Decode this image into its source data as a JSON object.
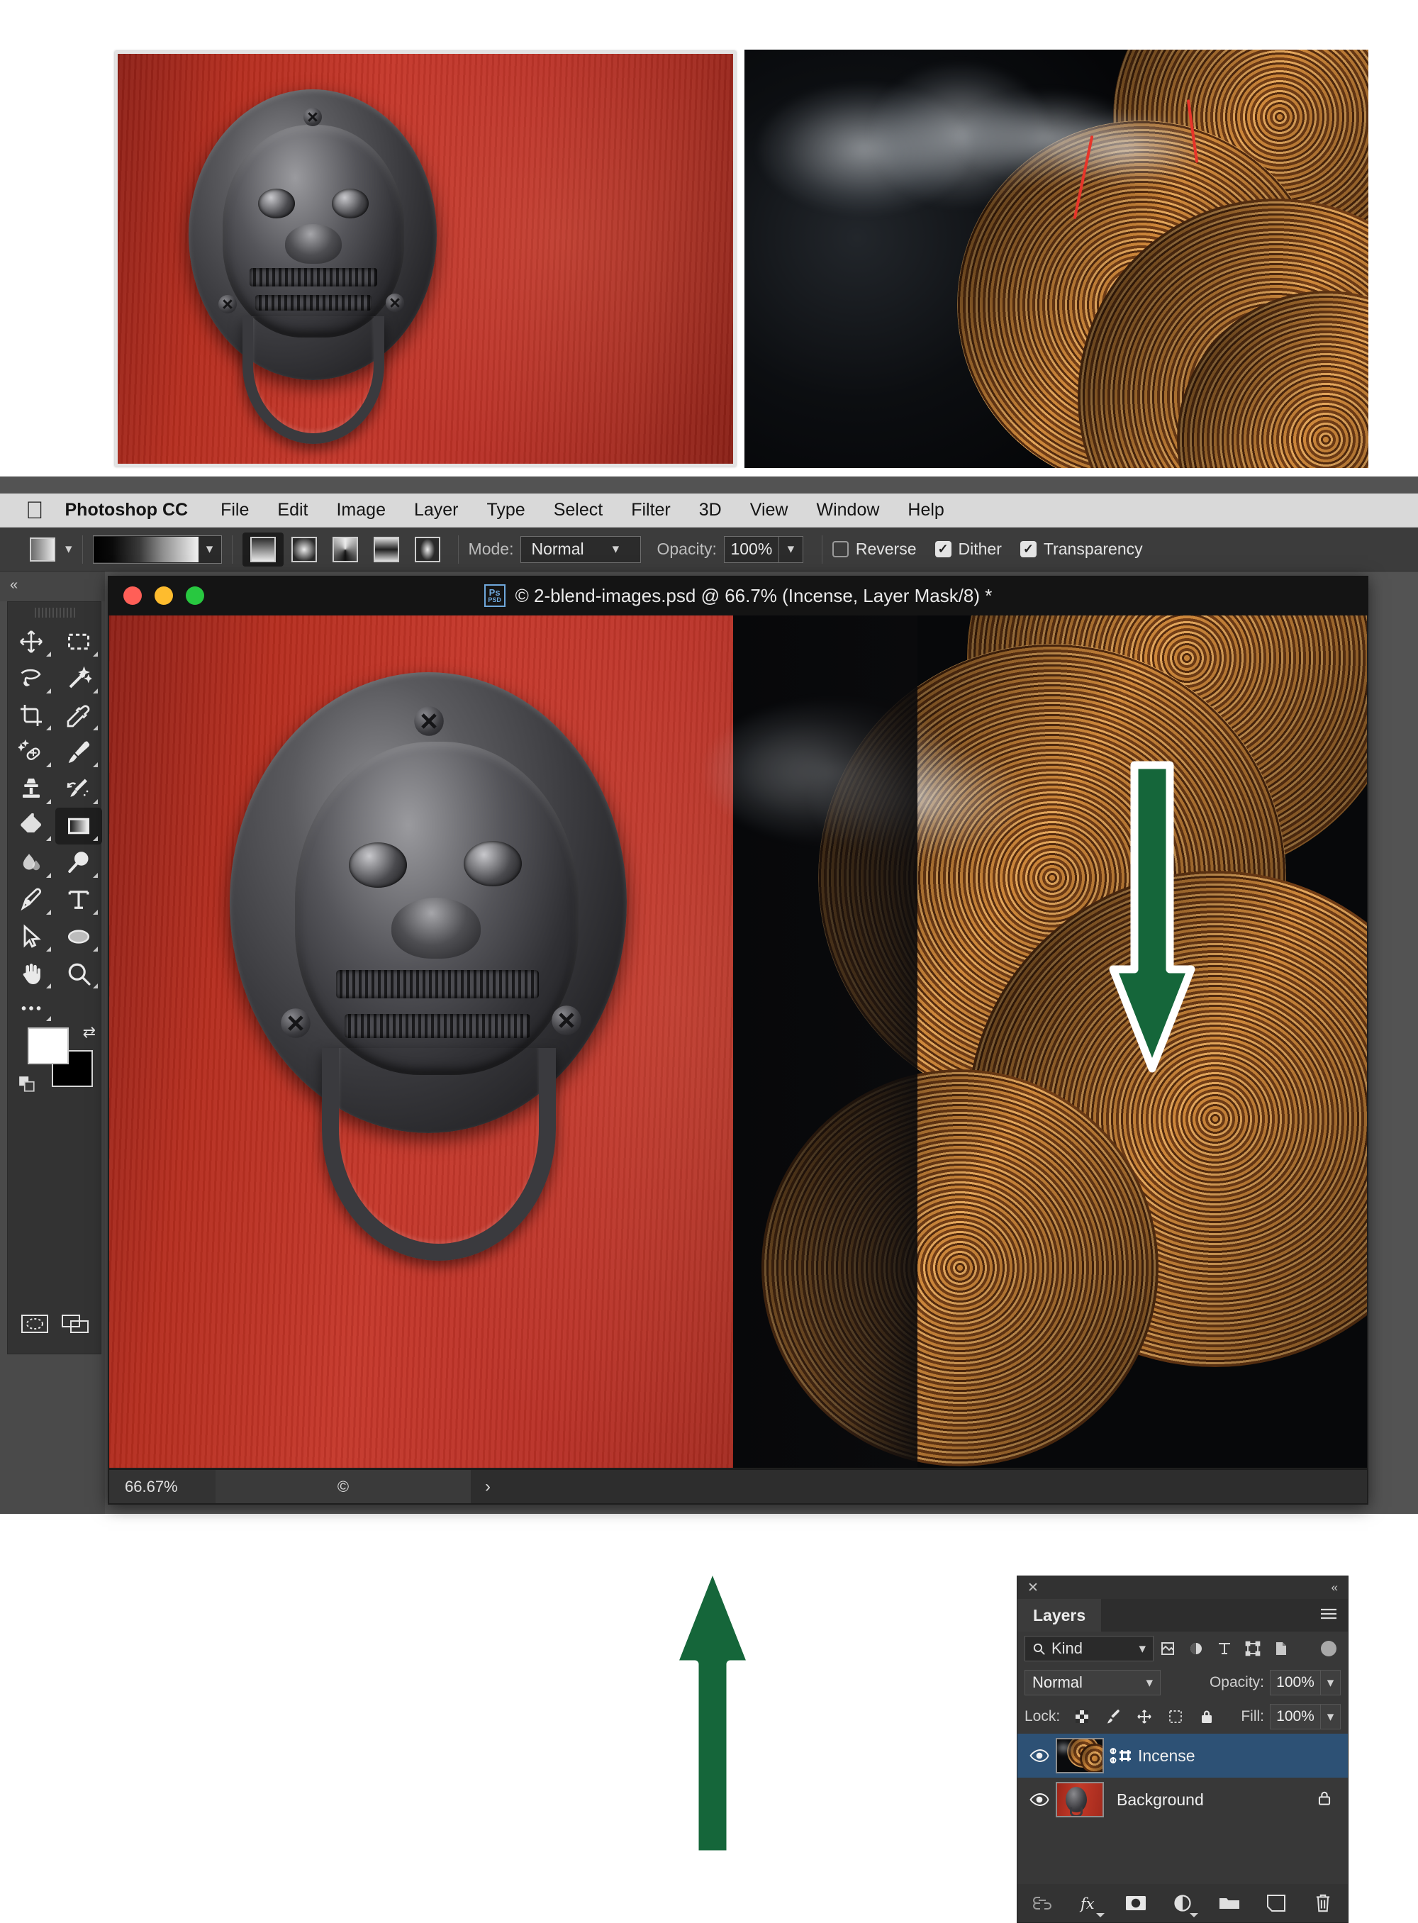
{
  "reference_images": [
    {
      "name": "door-knocker-photo",
      "alt": "Chinese lion-head door knocker on red door"
    },
    {
      "name": "incense-coils-photo",
      "alt": "Spiral incense coils with smoke on dark background"
    }
  ],
  "menubar": {
    "apple_glyph": "\u0001",
    "brand": "Photoshop CC",
    "items": [
      "File",
      "Edit",
      "Image",
      "Layer",
      "Type",
      "Select",
      "Filter",
      "3D",
      "View",
      "Window",
      "Help"
    ]
  },
  "options_bar": {
    "gradient_swatch_label": "gradient-swatch",
    "gradient_preview_label": "black-to-white-gradient",
    "gradient_types": [
      {
        "name": "linear-gradient",
        "active": true
      },
      {
        "name": "radial-gradient",
        "active": false
      },
      {
        "name": "angle-gradient",
        "active": false
      },
      {
        "name": "reflected-gradient",
        "active": false
      },
      {
        "name": "diamond-gradient",
        "active": false
      }
    ],
    "mode_label": "Mode:",
    "mode_value": "Normal",
    "opacity_label": "Opacity:",
    "opacity_value": "100%",
    "checkboxes": [
      {
        "label": "Reverse",
        "checked": false
      },
      {
        "label": "Dither",
        "checked": true
      },
      {
        "label": "Transparency",
        "checked": true
      }
    ]
  },
  "toolbar": {
    "collapse_glyph": "«",
    "tools": [
      {
        "name": "move-tool"
      },
      {
        "name": "rectangular-marquee-tool"
      },
      {
        "name": "lasso-tool"
      },
      {
        "name": "magic-wand-tool"
      },
      {
        "name": "crop-tool"
      },
      {
        "name": "eyedropper-tool"
      },
      {
        "name": "spot-healing-brush-tool"
      },
      {
        "name": "brush-tool"
      },
      {
        "name": "clone-stamp-tool"
      },
      {
        "name": "history-brush-tool"
      },
      {
        "name": "eraser-tool"
      },
      {
        "name": "gradient-tool"
      },
      {
        "name": "blur-tool"
      },
      {
        "name": "dodge-tool"
      },
      {
        "name": "pen-tool"
      },
      {
        "name": "type-tool"
      },
      {
        "name": "path-selection-tool"
      },
      {
        "name": "ellipse-tool"
      },
      {
        "name": "hand-tool"
      },
      {
        "name": "zoom-tool"
      }
    ],
    "selected_tool": "gradient-tool",
    "more_tools_glyph": "•••",
    "foreground_color": "#ffffff",
    "background_color": "#000000"
  },
  "document": {
    "title": "© 2-blend-images.psd @ 66.7% (Incense, Layer Mask/8) *",
    "ps_badge_top": "Ps",
    "ps_badge_bottom": "PSD",
    "traffic_lights": [
      "close",
      "minimize",
      "zoom"
    ]
  },
  "status_bar": {
    "zoom": "66.67%",
    "info": "©",
    "expand_glyph": "›"
  },
  "layers_panel": {
    "close_glyph": "✕",
    "collapse_glyph": "«",
    "tab_label": "Layers",
    "menu_glyph": "☰",
    "filter": {
      "kind_label": "Kind",
      "search_icon": "search-icon",
      "type_filters": [
        "pixel-layer-filter",
        "adjustment-layer-filter",
        "type-layer-filter",
        "shape-layer-filter",
        "smart-object-filter"
      ],
      "toggle_name": "filter-enable-toggle"
    },
    "blend_mode": "Normal",
    "opacity_label": "Opacity:",
    "opacity_value": "100%",
    "lock_label": "Lock:",
    "lock_icons": [
      "lock-transparent-pixels",
      "lock-image-pixels",
      "lock-position",
      "lock-artboard-nesting",
      "lock-all"
    ],
    "fill_label": "Fill:",
    "fill_value": "100%",
    "layers": [
      {
        "name": "Incense",
        "selected": true,
        "visible": true,
        "has_mask": true,
        "mask_linked": true,
        "mask_selected": true,
        "locked": false,
        "thumb": "incense-coils-thumb",
        "mask_thumb": "black-white-gradient-mask"
      },
      {
        "name": "Background",
        "selected": false,
        "visible": true,
        "has_mask": false,
        "locked": true,
        "thumb": "red-door-knocker-thumb"
      }
    ],
    "bottom_icons": [
      "link-layers-icon",
      "add-layer-style-icon",
      "add-layer-mask-icon",
      "new-adjustment-layer-icon",
      "new-group-icon",
      "new-layer-icon",
      "delete-layer-icon"
    ]
  },
  "annotations": {
    "arrow_color": "#15663a",
    "arrow_outline": "#ffffff",
    "arrows": [
      {
        "name": "arrow-pointing-up-at-blend-seam",
        "direction": "up"
      },
      {
        "name": "arrow-pointing-down-at-layer-mask",
        "direction": "down"
      }
    ]
  }
}
